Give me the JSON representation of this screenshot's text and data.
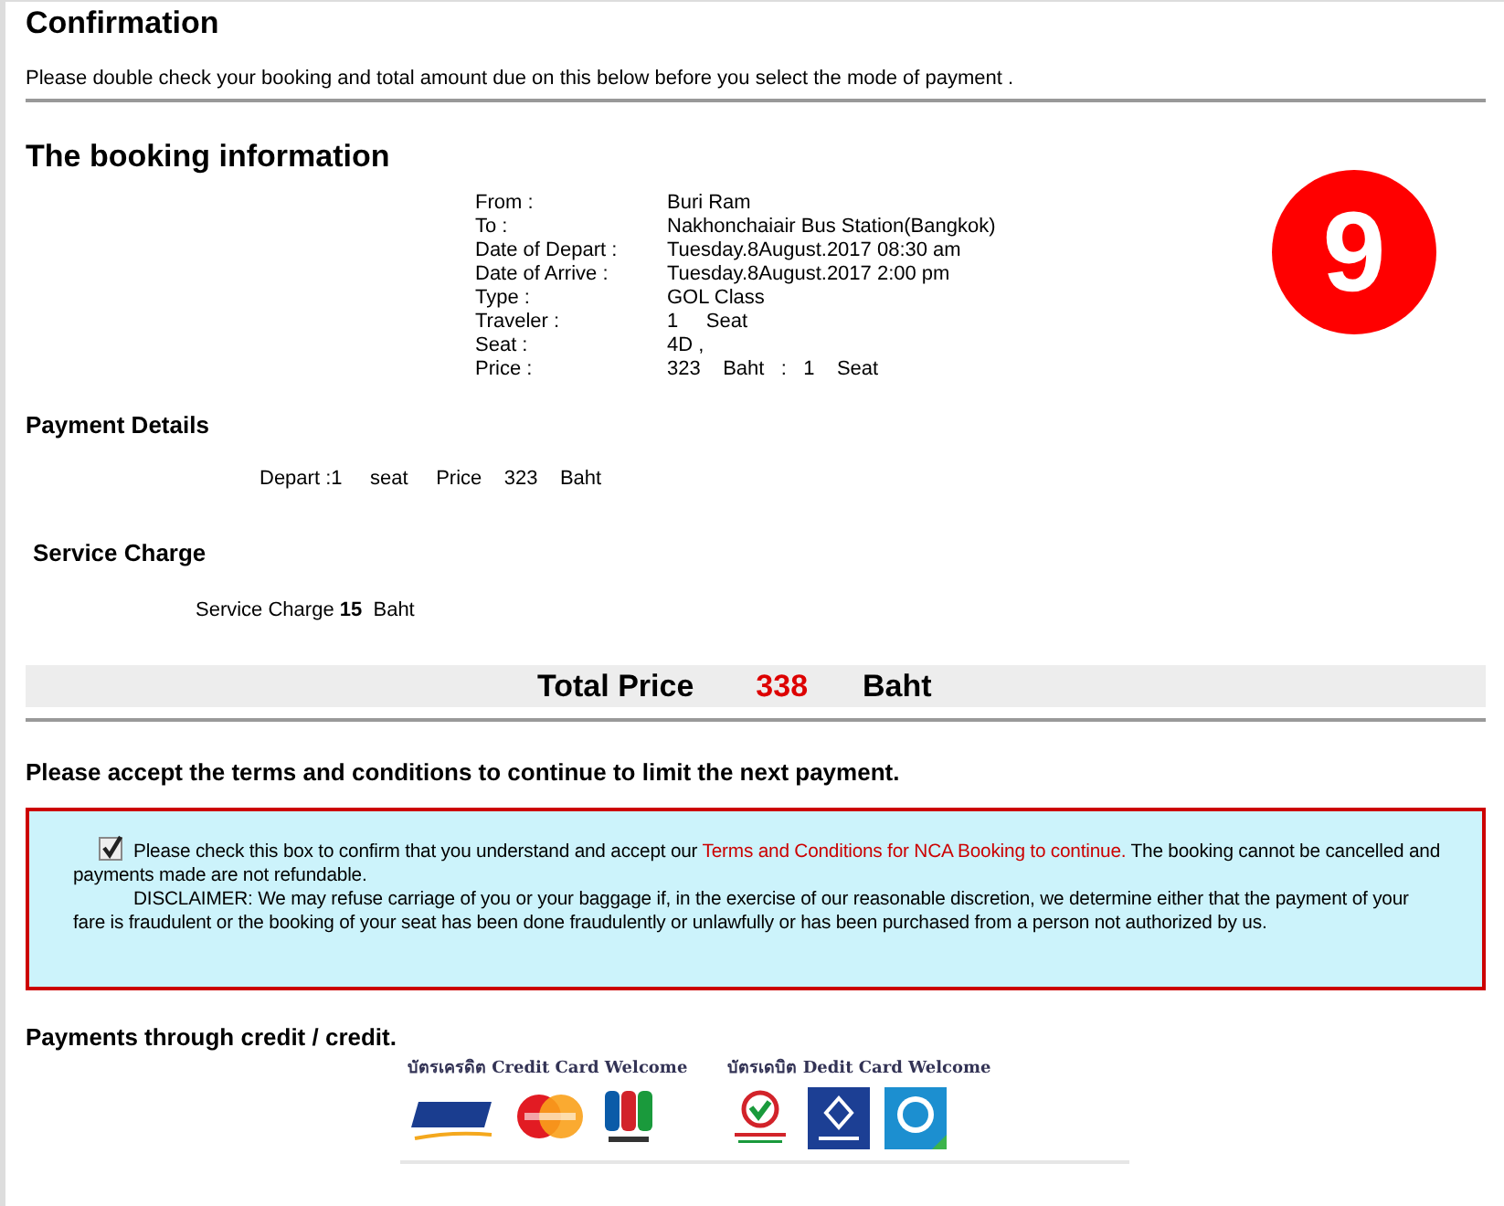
{
  "header": {
    "title": "Confirmation",
    "subtitle": "Please double check your booking and total amount due on this below before you select the mode of payment ."
  },
  "booking": {
    "title": "The booking information",
    "step_badge": "9",
    "rows": [
      {
        "label": "From :",
        "value": "Buri Ram"
      },
      {
        "label": "To :",
        "value": "Nakhonchaiair Bus Station(Bangkok)"
      },
      {
        "label": "Date of Depart :",
        "value": "Tuesday.8August.2017 08:30 am"
      },
      {
        "label": "Date of Arrive :",
        "value": "Tuesday.8August.2017 2:00 pm"
      },
      {
        "label": "Type :",
        "value": "GOL Class"
      },
      {
        "label": "Traveler :",
        "value": "1     Seat"
      },
      {
        "label": "Seat :",
        "value": "4D ,"
      },
      {
        "label": "Price :",
        "value": "323    Baht   :   1    Seat"
      }
    ]
  },
  "payment_details": {
    "title": "Payment Details",
    "line": "Depart :1     seat     Price    323    Baht"
  },
  "service_charge": {
    "title": "Service Charge",
    "line": "Service Charge **15**  Baht"
  },
  "total": {
    "label": "Total Price",
    "amount": "338",
    "currency": "Baht"
  },
  "terms": {
    "heading": "Please accept the terms and conditions to continue to limit the next payment.",
    "checked": true,
    "text_before": "Please check this box to confirm that you understand and accept our ",
    "link": "Terms and Conditions for NCA Booking to continue.",
    "text_after": " The booking cannot be cancelled and payments made are not refundable.",
    "disclaimer": "DISCLAIMER: We may refuse carriage of you or your baggage if, in the exercise of our reasonable discretion, we determine either that the payment of your fare is fraudulent or the booking of your seat has been done fraudulently or unlawfully or has been purchased from a person not authorized by us."
  },
  "payments": {
    "heading": "Payments through credit / credit.",
    "groups": [
      {
        "caption": "บัตรเครดิต Credit Card Welcome",
        "cards": [
          {
            "kind": "visa"
          },
          {
            "kind": "master"
          },
          {
            "kind": "jcb"
          }
        ]
      },
      {
        "caption": "บัตรเดบิต Dedit Card Welcome",
        "cards": [
          {
            "kind": "kbank"
          },
          {
            "kind": "bbl"
          },
          {
            "kind": "ktb"
          }
        ]
      }
    ]
  }
}
